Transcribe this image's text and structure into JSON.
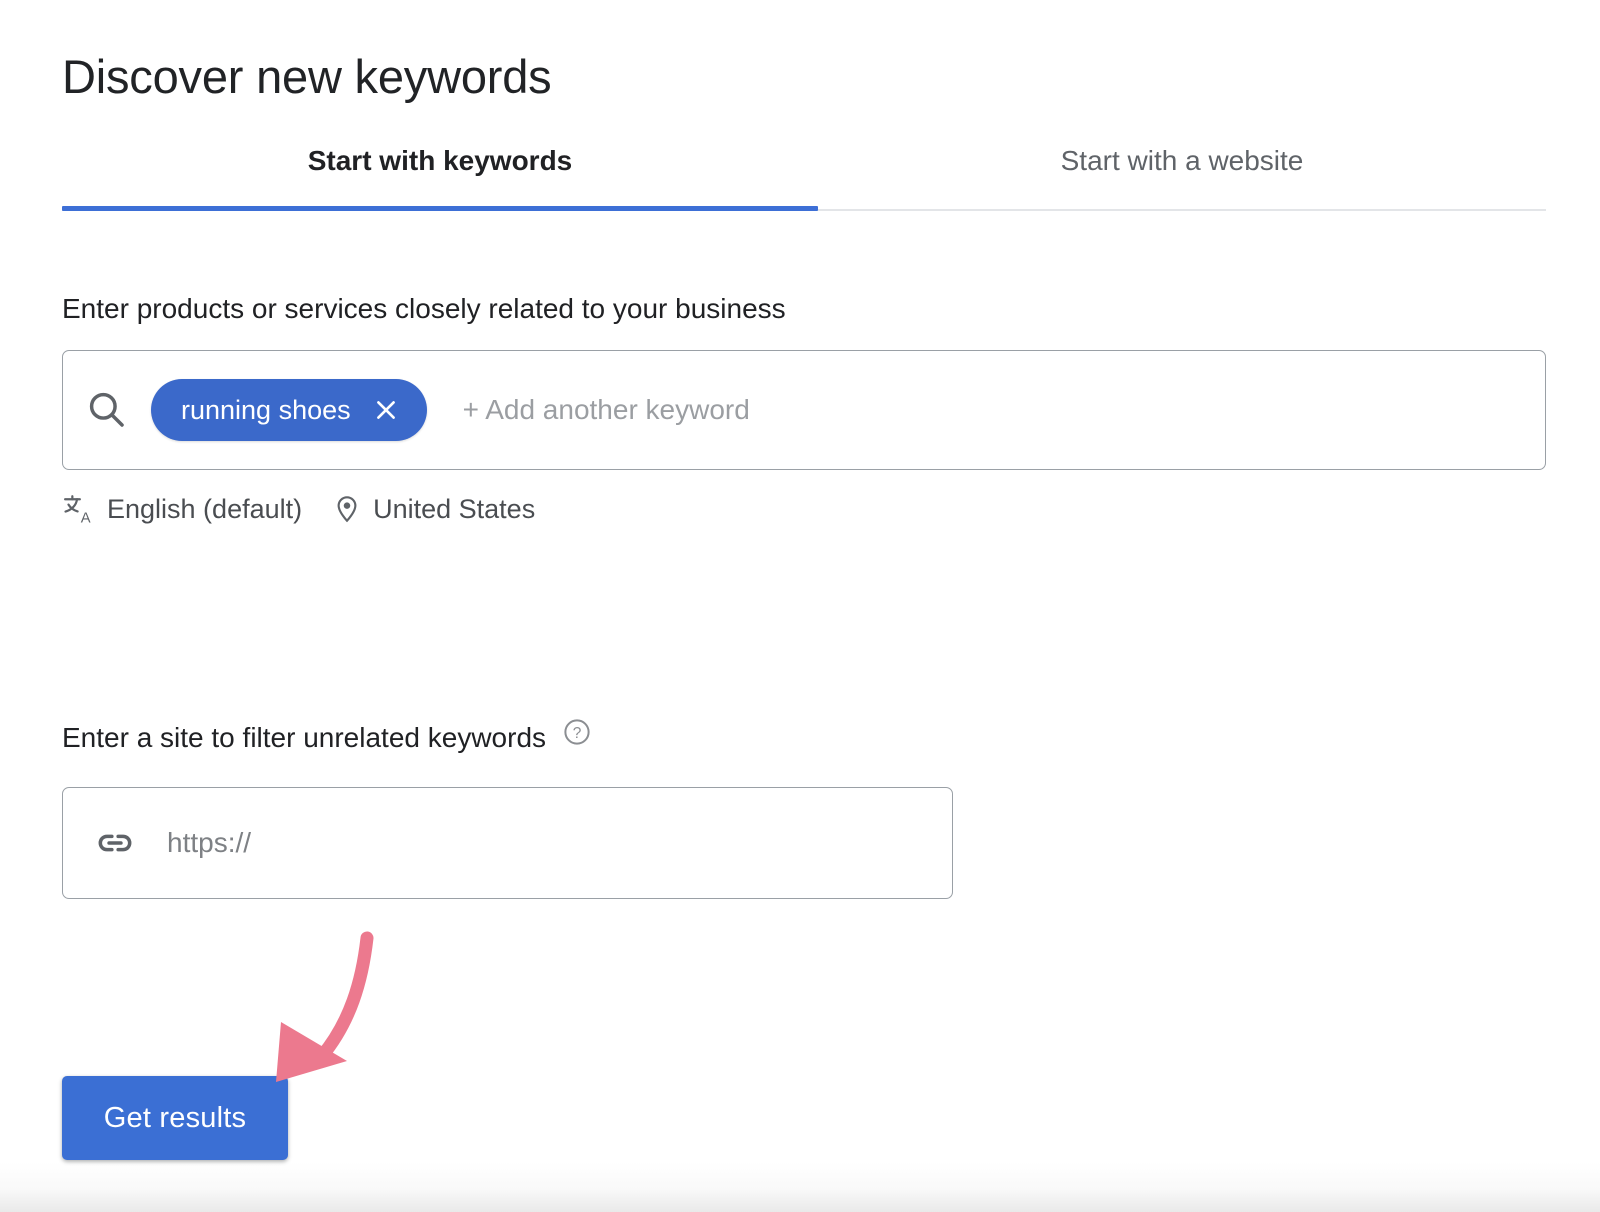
{
  "header": {
    "title": "Discover new keywords"
  },
  "tabs": {
    "items": [
      {
        "label": "Start with keywords",
        "selected": true
      },
      {
        "label": "Start with a website",
        "selected": false
      }
    ]
  },
  "keywords_section": {
    "label": "Enter products or services closely related to your business",
    "search_icon": "search-icon",
    "chips": [
      {
        "label": "running shoes",
        "close_icon": "close-icon"
      }
    ],
    "placeholder": "+ Add another keyword",
    "meta": [
      {
        "icon": "translate-icon",
        "label": "English (default)"
      },
      {
        "icon": "location-pin-icon",
        "label": "United States"
      }
    ]
  },
  "site_filter_section": {
    "label": "Enter a site to filter unrelated keywords",
    "help_icon": "help-circle-icon",
    "link_icon": "link-icon",
    "placeholder": "https://",
    "value": ""
  },
  "actions": {
    "get_results_label": "Get results"
  },
  "annotation": {
    "arrow_icon": "curved-arrow-annotation",
    "color": "#ec798e"
  },
  "colors": {
    "accent_blue": "#3b6fd4",
    "chip_blue": "#3b69ca",
    "tab_underline": "#3d6fd6",
    "text_primary": "#202124",
    "text_secondary": "#5f6368",
    "placeholder": "#9b9ea2",
    "border": "#9aa0a6",
    "annotation_pink": "#ec798e"
  }
}
